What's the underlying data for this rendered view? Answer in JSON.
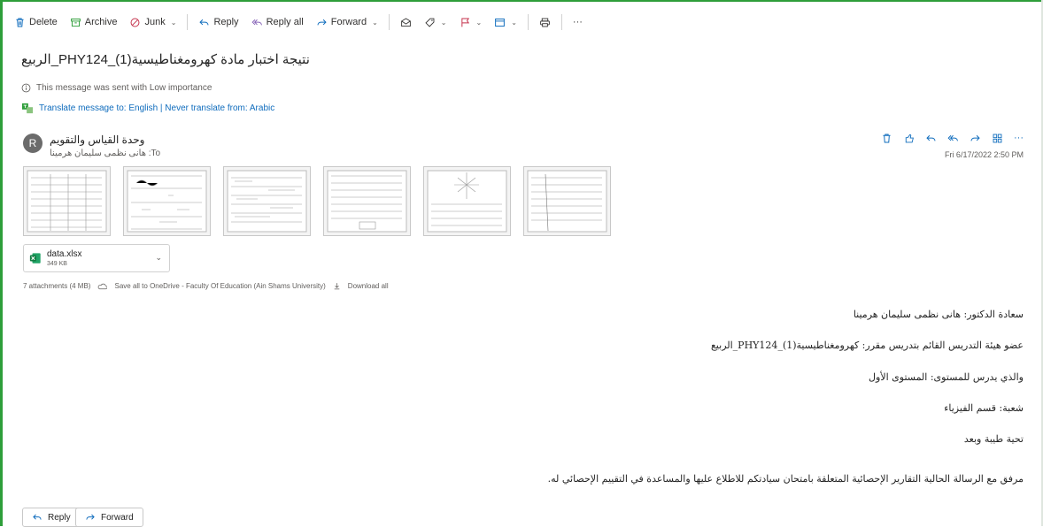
{
  "toolbar": {
    "delete_label": "Delete",
    "archive_label": "Archive",
    "junk_label": "Junk",
    "reply_label": "Reply",
    "reply_all_label": "Reply all",
    "forward_label": "Forward",
    "more_label": "···"
  },
  "message": {
    "subject": "الربيع_PHY124_نتيجة اختبار مادة كهرومغناطيسية(1)",
    "importance_note": "This message was sent with Low importance",
    "translate_note": "Translate message to: English | Never translate from: Arabic",
    "sender_name": "وحدة القياس والتقويم",
    "avatar_letter": "R",
    "to_line": "هانى نظمى سليمان هرمينا :To",
    "date": "Fri 6/17/2022 2:50 PM",
    "actions_more": "···"
  },
  "attachments": {
    "file_name": "data.xlsx",
    "file_size": "349 KB",
    "summary": "7 attachments (4 MB)",
    "save_label": "Save all to OneDrive - Faculty Of Education (Ain Shams University)",
    "download_label": "Download all",
    "thumbnail_count": 6
  },
  "body": {
    "lines": [
      "سعادة الدكتور: هانى نظمى سليمان هرمينا",
      "عضو هيئة التدريس القائم بتدريس مقرر: كهرومغناطيسية(1)_PHY124_الربيع",
      "والذي يدرس للمستوى: المستوى الأول",
      "شعبة: قسم الفيزياء",
      "تحية طيبة وبعد",
      "مرفق مع الرسالة الحالية التقارير الإحصائية المتعلقة بامتحان سيادتكم للاطلاع عليها والمساعدة في التقييم الإحصائي له."
    ]
  },
  "footer": {
    "reply_label": "Reply",
    "forward_label": "Forward"
  },
  "colors": {
    "accent": "#0f6cbd",
    "frame": "#2e9e3a",
    "flag": "#c4314b"
  },
  "icons": [
    "delete-icon",
    "archive-icon",
    "junk-icon",
    "reply-icon",
    "reply-all-icon",
    "forward-icon",
    "read-icon",
    "tag-icon",
    "flag-icon",
    "move-icon",
    "print-icon",
    "info-icon",
    "translate-icon",
    "excel-icon",
    "onedrive-icon",
    "download-icon"
  ]
}
